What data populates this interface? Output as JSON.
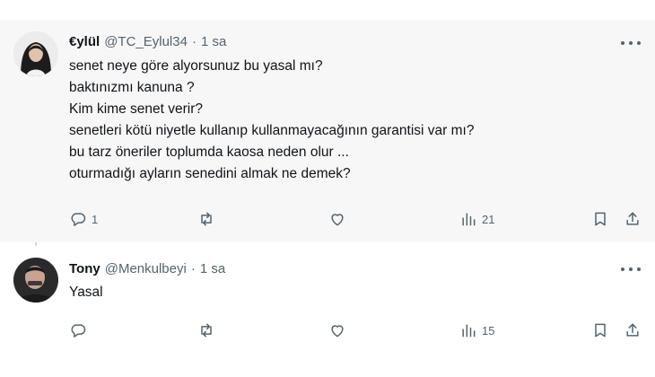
{
  "posts": [
    {
      "author": {
        "display_name": "€ylül",
        "handle": "@TC_Eylul34",
        "separator": "·",
        "time": "1 sa"
      },
      "lines": [
        "senet neye göre alyorsunuz bu yasal mı?",
        "baktınızmı kanuna ?",
        "Kim kime senet verir?",
        "senetleri kötü niyetle kullanıp kullanmayacağının garantisi var mı?",
        "bu tarz öneriler toplumda kaosa neden olur ...",
        "oturmadığı ayların senedini almak ne demek?"
      ],
      "stats": {
        "replies": "1",
        "reposts": "",
        "likes": "",
        "views": "21"
      }
    },
    {
      "author": {
        "display_name": "Tony",
        "handle": "@Menkulbeyi",
        "separator": "·",
        "time": "1 sa"
      },
      "lines": [
        "Yasal"
      ],
      "stats": {
        "replies": "",
        "reposts": "",
        "likes": "",
        "views": "15"
      }
    }
  ],
  "icons": {
    "reply": "reply-icon",
    "repost": "repost-icon",
    "like": "heart-icon",
    "views": "views-icon",
    "bookmark": "bookmark-icon",
    "share": "share-icon",
    "more": "more-icon"
  },
  "colors": {
    "text": "#0f1419",
    "secondary": "#536471",
    "highlight_background": "#f7f7f7",
    "thread_line": "#cfd9de"
  }
}
